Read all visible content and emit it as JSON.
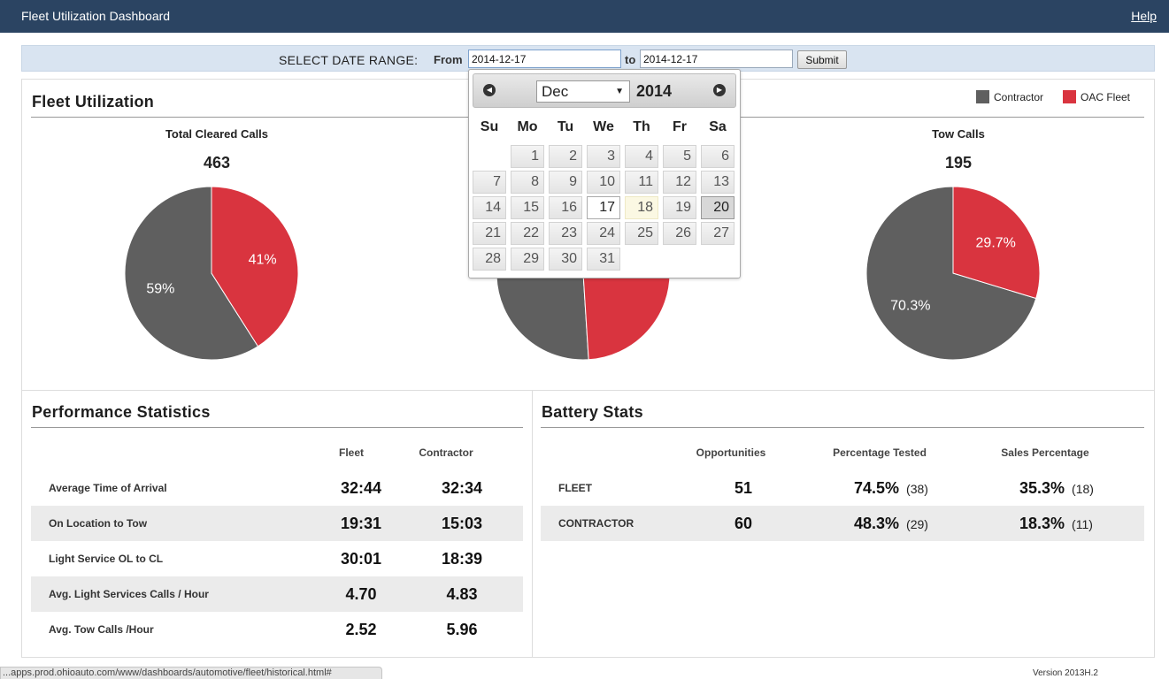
{
  "header": {
    "title": "Fleet Utilization Dashboard",
    "help_label": "Help"
  },
  "date_range": {
    "label": "SELECT DATE RANGE:",
    "from_label": "From",
    "from_value": "2014-12-17",
    "to_label": "to",
    "to_value": "2014-12-17",
    "submit_label": "Submit"
  },
  "calendar": {
    "month": "Dec",
    "year": "2014",
    "weekdays": [
      "Su",
      "Mo",
      "Tu",
      "We",
      "Th",
      "Fr",
      "Sa"
    ],
    "first_weekday_index": 1,
    "days_in_month": 31,
    "selected_day": 17,
    "today_day": 18,
    "hover_day": 20
  },
  "fleet_utilization": {
    "title": "Fleet Utilization",
    "legend": [
      {
        "label": "Contractor",
        "color": "#5f5f5f"
      },
      {
        "label": "OAC Fleet",
        "color": "#d9343f"
      }
    ],
    "charts": [
      {
        "title": "Total Cleared Calls",
        "total": "463",
        "contractor_label": "59%",
        "fleet_label": "41%",
        "fleet_fraction": 0.41
      },
      {
        "title": "",
        "total": "",
        "contractor_label": "",
        "fleet_label": "",
        "fleet_fraction": 0.49
      },
      {
        "title": "Tow Calls",
        "total": "195",
        "contractor_label": "70.3%",
        "fleet_label": "29.7%",
        "fleet_fraction": 0.297
      }
    ]
  },
  "chart_data": [
    {
      "type": "pie",
      "title": "Total Cleared Calls",
      "total": 463,
      "categories": [
        "Contractor",
        "OAC Fleet"
      ],
      "values": [
        59,
        41
      ]
    },
    {
      "type": "pie",
      "title": "Tow Calls",
      "total": 195,
      "categories": [
        "Contractor",
        "OAC Fleet"
      ],
      "values": [
        70.3,
        29.7
      ]
    }
  ],
  "performance": {
    "title": "Performance Statistics",
    "col_fleet": "Fleet",
    "col_contractor": "Contractor",
    "rows": [
      {
        "label": "Average Time of Arrival",
        "fleet": "32:44",
        "contractor": "32:34"
      },
      {
        "label": "On Location to Tow",
        "fleet": "19:31",
        "contractor": "15:03"
      },
      {
        "label": "Light Service OL to CL",
        "fleet": "30:01",
        "contractor": "18:39"
      },
      {
        "label": "Avg. Light Services Calls / Hour",
        "fleet": "4.70",
        "contractor": "4.83"
      },
      {
        "label": "Avg. Tow Calls /Hour",
        "fleet": "2.52",
        "contractor": "5.96"
      }
    ]
  },
  "battery": {
    "title": "Battery Stats",
    "col_opportunities": "Opportunities",
    "col_tested": "Percentage Tested",
    "col_sales": "Sales Percentage",
    "rows": [
      {
        "label": "FLEET",
        "opportunities": "51",
        "tested_pct": "74.5%",
        "tested_count": "(38)",
        "sales_pct": "35.3%",
        "sales_count": "(18)"
      },
      {
        "label": "CONTRACTOR",
        "opportunities": "60",
        "tested_pct": "48.3%",
        "tested_count": "(29)",
        "sales_pct": "18.3%",
        "sales_count": "(11)"
      }
    ]
  },
  "status_bar": {
    "url": "...apps.prod.ohioauto.com/www/dashboards/automotive/fleet/historical.html#"
  },
  "footer": {
    "version": "Version 2013H.2"
  }
}
